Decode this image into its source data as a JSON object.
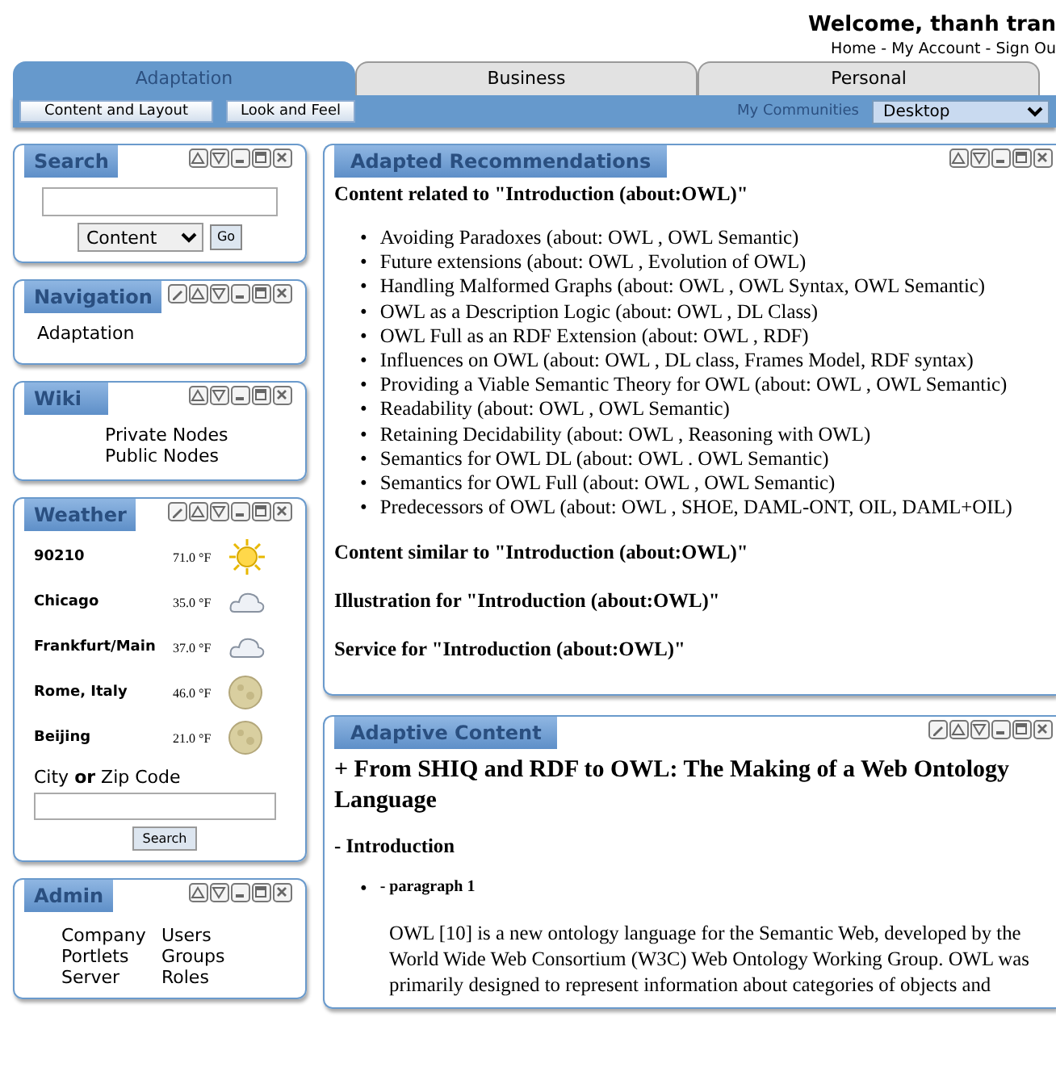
{
  "header": {
    "welcome": "Welcome, thanh tran",
    "links": [
      "Home",
      "My Account",
      "Sign Ou"
    ],
    "separator": "-"
  },
  "tabs": [
    {
      "label": "Adaptation",
      "selected": true
    },
    {
      "label": "Business",
      "selected": false
    },
    {
      "label": "Personal",
      "selected": false
    }
  ],
  "subbar": {
    "buttons": [
      "Content and Layout",
      "Look and Feel"
    ],
    "communities_label": "My Communities",
    "communities_value": "Desktop"
  },
  "sidebar": [
    {
      "kind": "search",
      "title": "Search",
      "controls": [
        {
          "kind": "up"
        },
        {
          "kind": "down"
        },
        {
          "kind": "minimize"
        },
        {
          "kind": "maximize"
        },
        {
          "kind": "close"
        }
      ],
      "select_value": "Content",
      "go": "Go"
    },
    {
      "kind": "list",
      "title": "Navigation",
      "controls": [
        {
          "kind": "edit"
        },
        {
          "kind": "up"
        },
        {
          "kind": "down"
        },
        {
          "kind": "minimize"
        },
        {
          "kind": "maximize"
        },
        {
          "kind": "close"
        }
      ],
      "links": [
        "Adaptation"
      ]
    },
    {
      "kind": "centered_list",
      "title": "Wiki",
      "controls": [
        {
          "kind": "up"
        },
        {
          "kind": "down"
        },
        {
          "kind": "minimize"
        },
        {
          "kind": "maximize"
        },
        {
          "kind": "close"
        }
      ],
      "links": [
        "Private Nodes",
        "Public Nodes"
      ]
    },
    {
      "kind": "weather",
      "title": "Weather",
      "controls": [
        {
          "kind": "edit"
        },
        {
          "kind": "up"
        },
        {
          "kind": "down"
        },
        {
          "kind": "minimize"
        },
        {
          "kind": "maximize"
        },
        {
          "kind": "close"
        }
      ],
      "rows": [
        {
          "city": "90210",
          "temp": "71.0 °F",
          "kind": "sunny"
        },
        {
          "city": "Chicago",
          "temp": "35.0 °F",
          "kind": "cloudy"
        },
        {
          "city": "Frankfurt/Main",
          "temp": "37.0 °F",
          "kind": "cloudy"
        },
        {
          "city": "Rome, Italy",
          "temp": "46.0 °F",
          "kind": "moon"
        },
        {
          "city": "Beijing",
          "temp": "21.0 °F",
          "kind": "moon"
        }
      ],
      "field_label": "City **or** Zip Code",
      "button": "Search"
    },
    {
      "kind": "grid",
      "title": "Admin",
      "controls": [
        {
          "kind": "up"
        },
        {
          "kind": "down"
        },
        {
          "kind": "minimize"
        },
        {
          "kind": "maximize"
        },
        {
          "kind": "close"
        }
      ],
      "links": [
        "Company",
        "Users",
        "Portlets",
        "Groups",
        "Server",
        "Roles"
      ]
    }
  ],
  "main": [
    {
      "kind": "recommendations",
      "title": "Adapted Recommendations",
      "controls": [
        {
          "kind": "up"
        },
        {
          "kind": "down"
        },
        {
          "kind": "minimize"
        },
        {
          "kind": "maximize"
        },
        {
          "kind": "close"
        }
      ],
      "heading": "Content related to \"Introduction (about:OWL)\"",
      "bullet": "•",
      "items": [
        "Avoiding Paradoxes (about: OWL , OWL Semantic)",
        "Future extensions (about: OWL , Evolution of OWL)",
        "Handling Malformed Graphs (about: OWL , OWL Syntax, OWL Semantic)",
        "OWL as a Description Logic (about: OWL , DL Class)",
        "OWL Full as an RDF Extension (about: OWL , RDF)",
        "Influences on OWL (about: OWL , DL class, Frames Model, RDF syntax)",
        "Providing a Viable Semantic Theory for OWL (about: OWL , OWL Semantic)",
        "Readability (about: OWL , OWL Semantic)",
        "Retaining Decidability (about: OWL , Reasoning with OWL)",
        "Semantics for OWL DL (about: OWL . OWL Semantic)",
        "Semantics for OWL Full (about: OWL , OWL Semantic)",
        "Predecessors of OWL (about: OWL , SHOE, DAML-ONT, OIL, DAML+OIL)"
      ],
      "sections": [
        "Content similar to \"Introduction (about:OWL)\"",
        "Illustration for \"Introduction (about:OWL)\"",
        "Service for \"Introduction (about:OWL)\""
      ]
    },
    {
      "kind": "content",
      "title": "Adaptive Content",
      "controls": [
        {
          "kind": "edit"
        },
        {
          "kind": "up"
        },
        {
          "kind": "down"
        },
        {
          "kind": "minimize"
        },
        {
          "kind": "maximize"
        },
        {
          "kind": "close"
        }
      ],
      "doc_title": "+ From SHIQ and RDF to OWL: The Making of a Web Ontology Language",
      "section": "- Introduction",
      "bullet": "•",
      "paragraph_label": "- paragraph 1",
      "paragraph": "OWL [10] is a new ontology language for the Semantic Web, developed by the World Wide Web Consortium (W3C) Web Ontology Working Group. OWL was primarily designed to represent information about categories of objects and"
    }
  ]
}
